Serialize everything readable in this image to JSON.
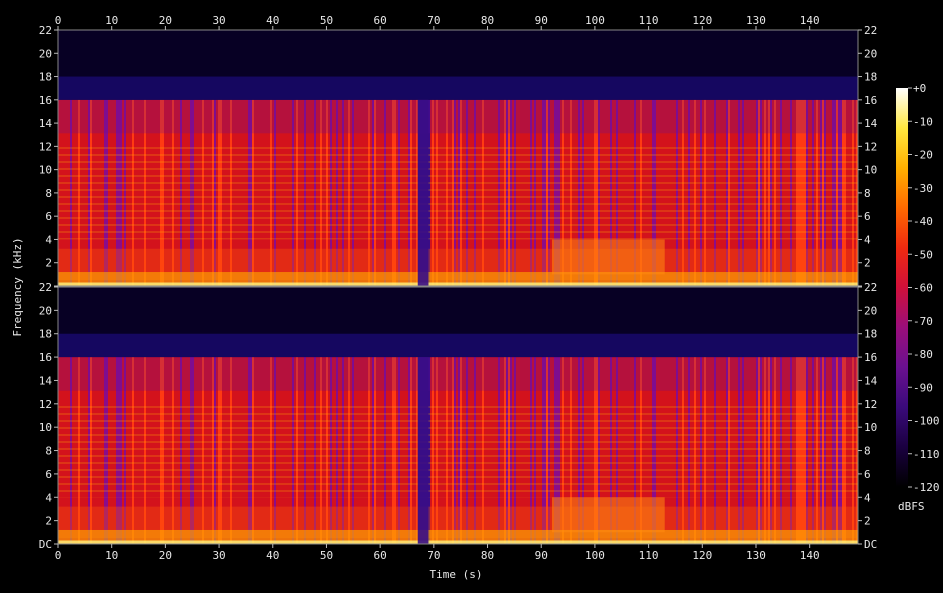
{
  "chart_data": {
    "type": "heatmap",
    "title": "",
    "xlabel": "Time (s)",
    "ylabel": "Frequency (kHz)",
    "xlim": [
      0,
      149
    ],
    "ylim_khz": [
      0,
      22
    ],
    "x_ticks": [
      0,
      10,
      20,
      30,
      40,
      50,
      60,
      70,
      80,
      90,
      100,
      110,
      120,
      130,
      140
    ],
    "y_ticks": [
      "DC",
      "2",
      "4",
      "6",
      "8",
      "10",
      "12",
      "14",
      "16",
      "18",
      "20",
      "22"
    ],
    "y_tick_values": [
      0,
      2,
      4,
      6,
      8,
      10,
      12,
      14,
      16,
      18,
      20,
      22
    ],
    "channels": 2,
    "colorbar": {
      "label": "dBFS",
      "ticks": [
        "+0",
        "-10",
        "-20",
        "-30",
        "-40",
        "-50",
        "-60",
        "-70",
        "-80",
        "-90",
        "-100",
        "-110",
        "-120"
      ],
      "range": [
        -120,
        0
      ],
      "colormap": [
        "#000000",
        "#1a0040",
        "#3a0a7a",
        "#6a1090",
        "#9a0e7a",
        "#d0103a",
        "#f02a10",
        "#ff6a00",
        "#ffb000",
        "#ffe840",
        "#ffffff"
      ]
    },
    "lowpass_cutoff_khz": 16,
    "quiet_segment_s": [
      67,
      69
    ],
    "notable_band": {
      "t_start_s": 92,
      "t_end_s": 113,
      "f_low_khz": 1,
      "f_high_khz": 4
    }
  }
}
